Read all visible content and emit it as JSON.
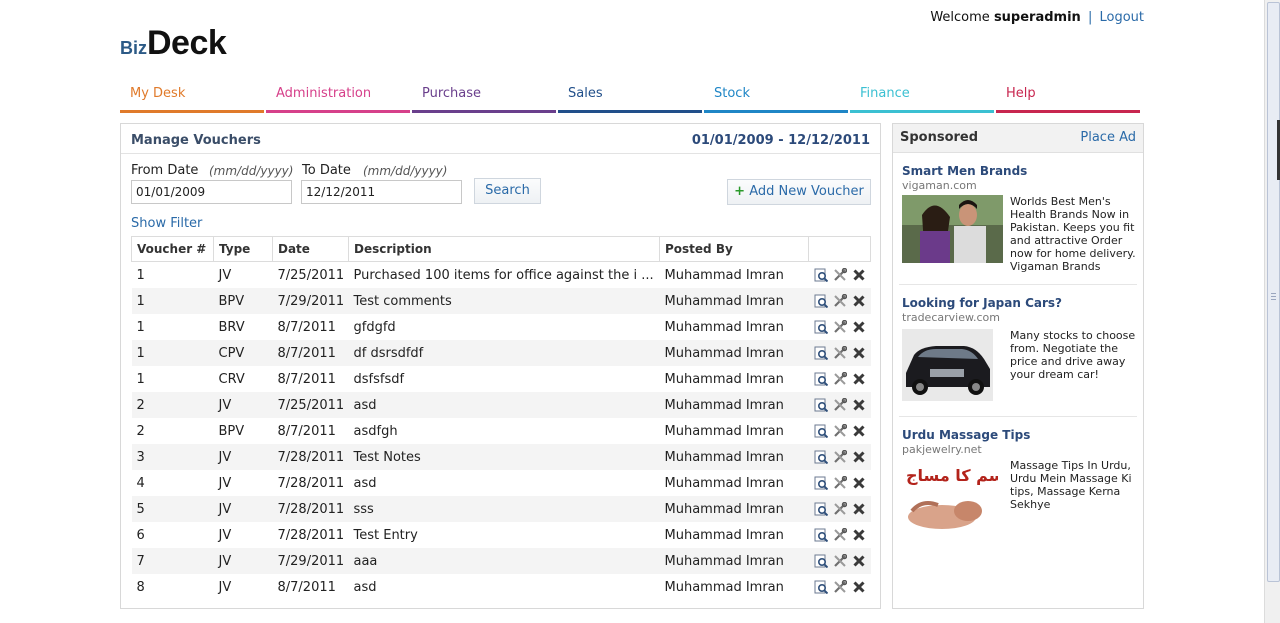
{
  "header": {
    "welcome_text": "Welcome",
    "username": "superadmin",
    "separator": "|",
    "logout_label": "Logout",
    "logo_biz": "Biz",
    "logo_deck": "Deck"
  },
  "nav": [
    {
      "label": "My Desk",
      "color": "#e07a2a"
    },
    {
      "label": "Administration",
      "color": "#d6408a"
    },
    {
      "label": "Purchase",
      "color": "#6a3f8c"
    },
    {
      "label": "Sales",
      "color": "#214f8a"
    },
    {
      "label": "Stock",
      "color": "#1f86c6"
    },
    {
      "label": "Finance",
      "color": "#3bc0d2"
    },
    {
      "label": "Help",
      "color": "#c8264f"
    }
  ],
  "main": {
    "title": "Manage Vouchers",
    "date_range": "01/01/2009 - 12/12/2011",
    "from_label": "From Date",
    "from_hint": "(mm/dd/yyyy)",
    "from_value": "01/01/2009",
    "to_label": "To Date",
    "to_hint": "(mm/dd/yyyy)",
    "to_value": "12/12/2011",
    "search_label": "Search",
    "add_label": "Add New Voucher",
    "add_plus": "+",
    "show_filter": "Show Filter"
  },
  "table": {
    "headers": [
      "Voucher #",
      "Type",
      "Date",
      "Description",
      "Posted By",
      ""
    ],
    "rows": [
      {
        "num": "1",
        "type": "JV",
        "date": "7/25/2011",
        "desc": "Purchased 100 items for office against the i ...",
        "by": "Muhammad Imran"
      },
      {
        "num": "1",
        "type": "BPV",
        "date": "7/29/2011",
        "desc": "Test comments",
        "by": "Muhammad Imran"
      },
      {
        "num": "1",
        "type": "BRV",
        "date": "8/7/2011",
        "desc": "gfdgfd",
        "by": "Muhammad Imran"
      },
      {
        "num": "1",
        "type": "CPV",
        "date": "8/7/2011",
        "desc": "df dsrsdfdf",
        "by": "Muhammad Imran"
      },
      {
        "num": "1",
        "type": "CRV",
        "date": "8/7/2011",
        "desc": "dsfsfsdf",
        "by": "Muhammad Imran"
      },
      {
        "num": "2",
        "type": "JV",
        "date": "7/25/2011",
        "desc": "asd",
        "by": "Muhammad Imran"
      },
      {
        "num": "2",
        "type": "BPV",
        "date": "8/7/2011",
        "desc": "asdfgh",
        "by": "Muhammad Imran"
      },
      {
        "num": "3",
        "type": "JV",
        "date": "7/28/2011",
        "desc": "Test Notes",
        "by": "Muhammad Imran"
      },
      {
        "num": "4",
        "type": "JV",
        "date": "7/28/2011",
        "desc": "asd",
        "by": "Muhammad Imran"
      },
      {
        "num": "5",
        "type": "JV",
        "date": "7/28/2011",
        "desc": "sss",
        "by": "Muhammad Imran"
      },
      {
        "num": "6",
        "type": "JV",
        "date": "7/28/2011",
        "desc": "Test Entry",
        "by": "Muhammad Imran"
      },
      {
        "num": "7",
        "type": "JV",
        "date": "7/29/2011",
        "desc": "aaa",
        "by": "Muhammad Imran"
      },
      {
        "num": "8",
        "type": "JV",
        "date": "8/7/2011",
        "desc": "asd",
        "by": "Muhammad Imran"
      }
    ],
    "row_icons": [
      "view-icon",
      "edit-icon",
      "delete-icon"
    ]
  },
  "sponsored": {
    "title": "Sponsored",
    "place_ad": "Place Ad",
    "ads": [
      {
        "title": "Smart Men Brands",
        "url": "vigaman.com",
        "body": "Worlds Best Men's Health Brands Now in Pakistan. Keeps you fit and attractive Order now for home delivery. Vigaman Brands"
      },
      {
        "title": "Looking for Japan Cars?",
        "url": "tradecarview.com",
        "body": "Many stocks to choose from. Negotiate the price and drive away your dream car!"
      },
      {
        "title": "Urdu Massage Tips",
        "url": "pakjewelry.net",
        "body": "Massage Tips In Urdu, Urdu Mein Massage Ki tips, Massage Kerna Sekhye",
        "image_text": "جسم کا مساج"
      }
    ]
  }
}
